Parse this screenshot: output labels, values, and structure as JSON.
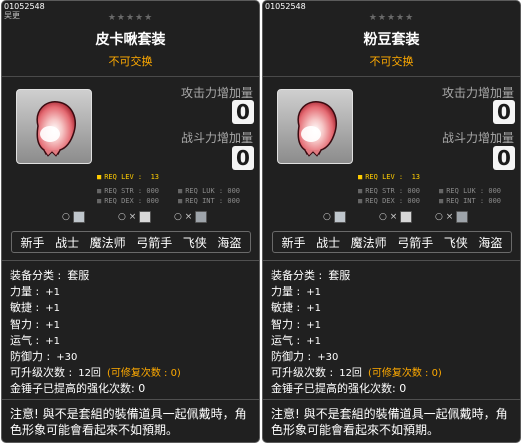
{
  "cards": [
    {
      "item_id": "01052548",
      "sub_label": "吴更",
      "stars": "★★★★★",
      "name": "皮卡啾套装",
      "trade": "不可交换",
      "attack_label": "攻击力增加量",
      "attack_value": "0",
      "combat_label": "战斗力增加量",
      "combat_value": "0",
      "req_lev": "REQ LEV :  13",
      "req_str": "REQ STR : 000",
      "req_dex": "REQ DEX : 000",
      "req_luk": "REQ LUK : 000",
      "req_int": "REQ INT : 000",
      "elem_1": "○",
      "elem_2": "○ ×",
      "elem_3": "○ ×",
      "jobs": [
        "新手",
        "战士",
        "魔法师",
        "弓箭手",
        "飞侠",
        "海盗"
      ],
      "category_label": "装备分类 :",
      "category_value": "套服",
      "str_label": "力量 :",
      "str_value": "+1",
      "dex_label": "敏捷 :",
      "dex_value": "+1",
      "int_label": "智力 :",
      "int_value": "+1",
      "luk_label": "运气 :",
      "luk_value": "+1",
      "def_label": "防御力 :",
      "def_value": "+30",
      "upgrade_label": "可升级次数 :",
      "upgrade_value": "12回",
      "repair_text": "(可修复次数 : 0)",
      "hammer_text": "金锤子已提高的强化次数: 0",
      "notice": "注意! 與不是套組的裝備道具一起佩戴時，角色形象可能會看起來不如預期。"
    },
    {
      "item_id": "01052548",
      "stars": "★★★★★",
      "name": "粉豆套装",
      "trade": "不可交换",
      "attack_label": "攻击力增加量",
      "attack_value": "0",
      "combat_label": "战斗力增加量",
      "combat_value": "0",
      "req_lev": "REQ LEV :  13",
      "req_str": "REQ STR : 000",
      "req_dex": "REQ DEX : 000",
      "req_luk": "REQ LUK : 000",
      "req_int": "REQ INT : 000",
      "elem_1": "○",
      "elem_2": "○ ×",
      "elem_3": "○ ×",
      "jobs": [
        "新手",
        "战士",
        "魔法师",
        "弓箭手",
        "飞侠",
        "海盗"
      ],
      "category_label": "装备分类 :",
      "category_value": "套服",
      "str_label": "力量 :",
      "str_value": "+1",
      "dex_label": "敏捷 :",
      "dex_value": "+1",
      "int_label": "智力 :",
      "int_value": "+1",
      "luk_label": "运气 :",
      "luk_value": "+1",
      "def_label": "防御力 :",
      "def_value": "+30",
      "upgrade_label": "可升级次数 :",
      "upgrade_value": "12回",
      "repair_text": "(可修复次数 : 0)",
      "hammer_text": "金锤子已提高的强化次数: 0",
      "notice": "注意! 與不是套組的裝備道具一起佩戴時，角色形象可能會看起來不如預期。"
    }
  ],
  "colors": {
    "background": "#202020",
    "highlight": "#ffaa00",
    "req_highlight": "#ffcc00",
    "muted": "#8a8a8a",
    "value_box": "#f4f4f4"
  },
  "icons": {
    "item_icon": "pink-egg-outfit-icon",
    "element_icons": [
      "elemental-resist-icon",
      "status-resist-icon",
      "defense-resist-icon"
    ]
  }
}
